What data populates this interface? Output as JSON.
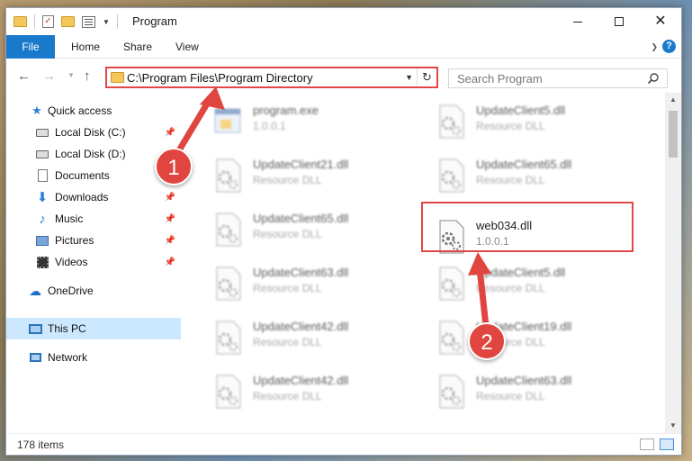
{
  "window": {
    "title": "Program"
  },
  "ribbon": {
    "tabs": [
      "File",
      "Home",
      "Share",
      "View"
    ]
  },
  "address": {
    "path": "C:\\Program Files\\Program Directory"
  },
  "search": {
    "placeholder": "Search Program"
  },
  "sidebar": {
    "items": [
      {
        "label": "Quick access",
        "icon": "star-icon",
        "pinned": false
      },
      {
        "label": "Local Disk (C:)",
        "icon": "drive-icon",
        "pinned": true
      },
      {
        "label": "Local Disk (D:)",
        "icon": "drive-icon",
        "pinned": false
      },
      {
        "label": "Documents",
        "icon": "documents-icon",
        "pinned": true
      },
      {
        "label": "Downloads",
        "icon": "download-icon",
        "pinned": true
      },
      {
        "label": "Music",
        "icon": "music-icon",
        "pinned": true
      },
      {
        "label": "Pictures",
        "icon": "pictures-icon",
        "pinned": true
      },
      {
        "label": "Videos",
        "icon": "videos-icon",
        "pinned": true
      },
      {
        "label": "OneDrive",
        "icon": "cloud-icon",
        "pinned": false
      },
      {
        "label": "This PC",
        "icon": "computer-icon",
        "pinned": false,
        "selected": true
      },
      {
        "label": "Network",
        "icon": "network-icon",
        "pinned": false
      }
    ]
  },
  "files": [
    {
      "name": "program.exe",
      "desc": "1.0.0.1",
      "blurred": true
    },
    {
      "name": "UpdateClient5.dll",
      "desc": "Resource DLL",
      "blurred": true
    },
    {
      "name": "UpdateClient21.dll",
      "desc": "Resource DLL",
      "blurred": true
    },
    {
      "name": "UpdateClient65.dll",
      "desc": "Resource DLL",
      "blurred": true
    },
    {
      "name": "UpdateClient65.dll",
      "desc": "Resource DLL",
      "blurred": true
    },
    {
      "name": "web034.dll",
      "desc": "1.0.0.1",
      "blurred": false
    },
    {
      "name": "UpdateClient63.dll",
      "desc": "Resource DLL",
      "blurred": true
    },
    {
      "name": "UpdateClient5.dll",
      "desc": "Resource DLL",
      "blurred": true
    },
    {
      "name": "UpdateClient42.dll",
      "desc": "Resource DLL",
      "blurred": true
    },
    {
      "name": "UpdateClient19.dll",
      "desc": "Resource DLL",
      "blurred": true
    },
    {
      "name": "UpdateClient42.dll",
      "desc": "Resource DLL",
      "blurred": true
    },
    {
      "name": "UpdateClient63.dll",
      "desc": "Resource DLL",
      "blurred": true
    }
  ],
  "status": {
    "item_count": "178 items"
  },
  "annotations": {
    "step1": "1",
    "step2": "2",
    "color": "#e0463f"
  },
  "colors": {
    "accent": "#1979ca",
    "highlight": "#e04848",
    "selected": "#cce8ff"
  }
}
